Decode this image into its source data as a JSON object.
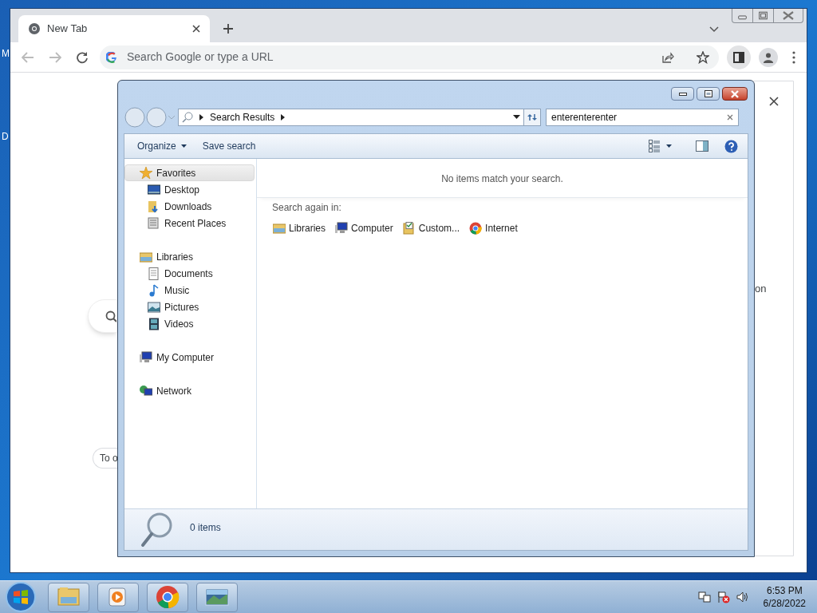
{
  "desktop": {
    "icon_labels": [
      "M",
      "D"
    ]
  },
  "browser": {
    "tabs": [
      {
        "title": "New Tab",
        "selected": true
      }
    ],
    "omnibox": {
      "placeholder": "Search Google or type a URL"
    },
    "page": {
      "side_panel_text": "on",
      "shortcut_chip": "To o"
    }
  },
  "explorer": {
    "breadcrumb": [
      "Search Results"
    ],
    "search_field": {
      "value": "enterenterenter"
    },
    "toolbar": [
      "Organize",
      "Save search"
    ],
    "nav": [
      {
        "label": "Favorites",
        "kind": "star",
        "selected": true,
        "children": [
          {
            "label": "Desktop",
            "kind": "desktop",
            "selected": false
          },
          {
            "label": "Downloads",
            "kind": "downloads",
            "selected": false
          },
          {
            "label": "Recent Places",
            "kind": "recent",
            "selected": false
          }
        ]
      },
      {
        "label": "Libraries",
        "kind": "library",
        "selected": false,
        "children": [
          {
            "label": "Documents",
            "kind": "document",
            "selected": false
          },
          {
            "label": "Music",
            "kind": "music",
            "selected": false
          },
          {
            "label": "Pictures",
            "kind": "pictures",
            "selected": false
          },
          {
            "label": "Videos",
            "kind": "videos",
            "selected": false
          }
        ]
      },
      {
        "label": "My Computer",
        "kind": "computer",
        "selected": false
      },
      {
        "label": "Network",
        "kind": "network",
        "selected": false
      }
    ],
    "message": "No items match your search.",
    "search_again": {
      "label": "Search again in:",
      "locations": [
        {
          "label": "Libraries",
          "kind": "library"
        },
        {
          "label": "Computer",
          "kind": "computer"
        },
        {
          "label": "Custom...",
          "kind": "custom"
        },
        {
          "label": "Internet",
          "kind": "browser"
        }
      ]
    },
    "status": "0 items"
  },
  "taskbar": {
    "apps": [
      {
        "kind": "explorer"
      },
      {
        "kind": "media"
      },
      {
        "kind": "browser"
      },
      {
        "kind": "photos"
      }
    ],
    "time": "6:53 PM",
    "date": "6/28/2022"
  }
}
